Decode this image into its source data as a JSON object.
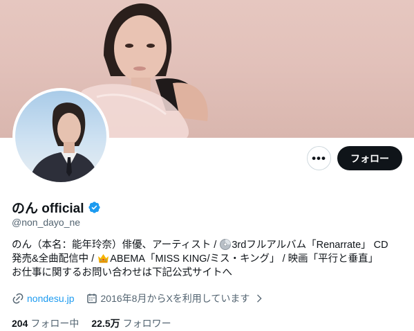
{
  "profile": {
    "display_name": "のん official",
    "handle": "@non_dayo_ne",
    "verified_icon": "verified-badge-icon",
    "bio": {
      "line1_a": "のん（本名：能年玲奈）俳優、アーティスト / ",
      "line1_b": "3rdフルアルバム「Renarrate」 CD",
      "line2_a": "発売&全曲配信中 / ",
      "line2_b": "ABEMA「MISS KING/ミス・キング」 / 映画「平行と垂直」",
      "line3": "お仕事に関するお問い合わせは下記公式サイトへ"
    },
    "website": "nondesu.jp",
    "joined": "2016年8月からXを利用しています",
    "following_count": "204",
    "following_label": "フォロー中",
    "followers_count": "22.5万",
    "followers_label": "フォロワー"
  },
  "actions": {
    "more_label": "•••",
    "follow_label": "フォロー"
  },
  "colors": {
    "accent": "#1d9bf0",
    "text": "#0f1419",
    "muted": "#536471",
    "button_dark": "#0f1419"
  }
}
